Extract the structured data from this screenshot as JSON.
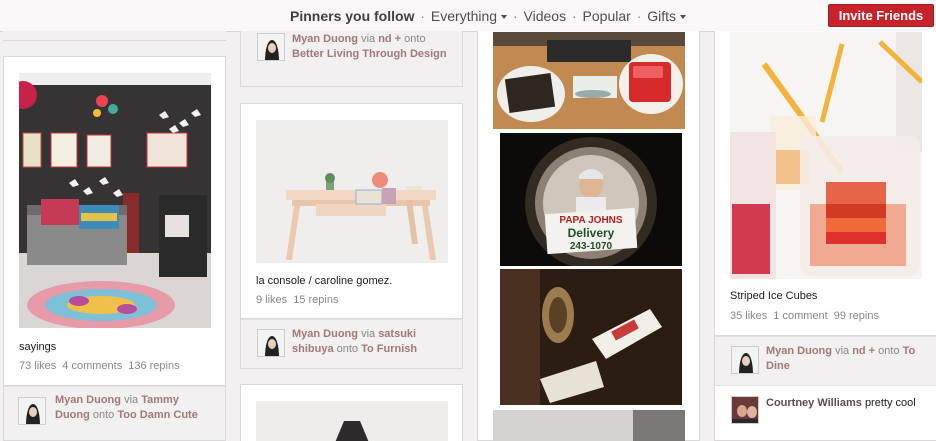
{
  "nav": {
    "pinners_you_follow": "Pinners you follow",
    "everything": "Everything",
    "videos": "Videos",
    "popular": "Popular",
    "gifts": "Gifts",
    "sep": "·",
    "invite": "Invite Friends"
  },
  "pins": {
    "top_col2": {
      "user": "Myan Duong",
      "via_word": "via",
      "via_user": "nd +",
      "onto_word": "onto",
      "board": "Better Living Through Design"
    },
    "sayings": {
      "desc": "sayings",
      "likes": "73 likes",
      "comments": "4 comments",
      "repins": "136 repins",
      "user": "Myan Duong",
      "via_word": "via",
      "via_user": "Tammy Duong",
      "onto_word": "onto",
      "board": "Too Damn Cute"
    },
    "console": {
      "desc": "la console / caroline gomez.",
      "likes": "9 likes",
      "repins": "15 repins",
      "user": "Myan Duong",
      "via_word": "via",
      "via_user": "satsuki shibuya",
      "onto_word": "onto",
      "board": "To Furnish"
    },
    "delivery": {
      "box_brand": "PAPA JOHNS",
      "box_title": "Delivery",
      "box_number": "243-1070"
    },
    "ice": {
      "desc": "Striped Ice Cubes",
      "likes": "35 likes",
      "comments": "1 comment",
      "repins": "99 repins",
      "user": "Myan Duong",
      "via_word": "via",
      "via_user": "nd +",
      "onto_word": "onto",
      "board": "To Dine",
      "commenter": "Courtney Williams",
      "comment": "pretty cool"
    }
  },
  "colors": {
    "invite_bg": "#c8222b",
    "page_bg": "#f2f0f0"
  }
}
